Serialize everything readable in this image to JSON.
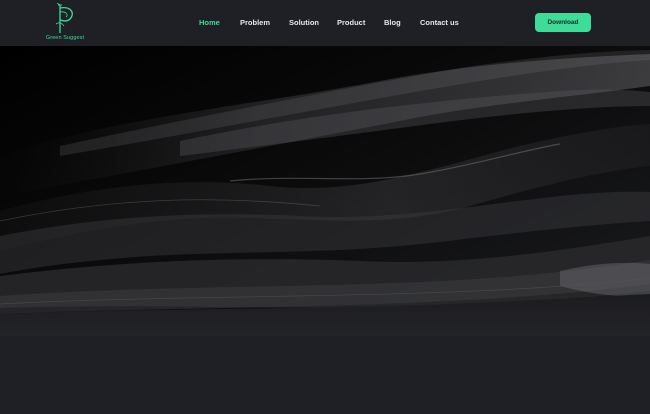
{
  "brand": {
    "name": "Green Suggest",
    "accent_color": "#3ddc97",
    "logo_icon": "feather-quill-p-icon"
  },
  "nav": {
    "items": [
      {
        "label": "Home",
        "active": true
      },
      {
        "label": "Problem",
        "active": false
      },
      {
        "label": "Solution",
        "active": false
      },
      {
        "label": "Product",
        "active": false
      },
      {
        "label": "Blog",
        "active": false
      },
      {
        "label": "Contact us",
        "active": false
      }
    ],
    "cta_label": "Download"
  },
  "hero": {
    "image": "dark-silk-fabric-waves"
  }
}
